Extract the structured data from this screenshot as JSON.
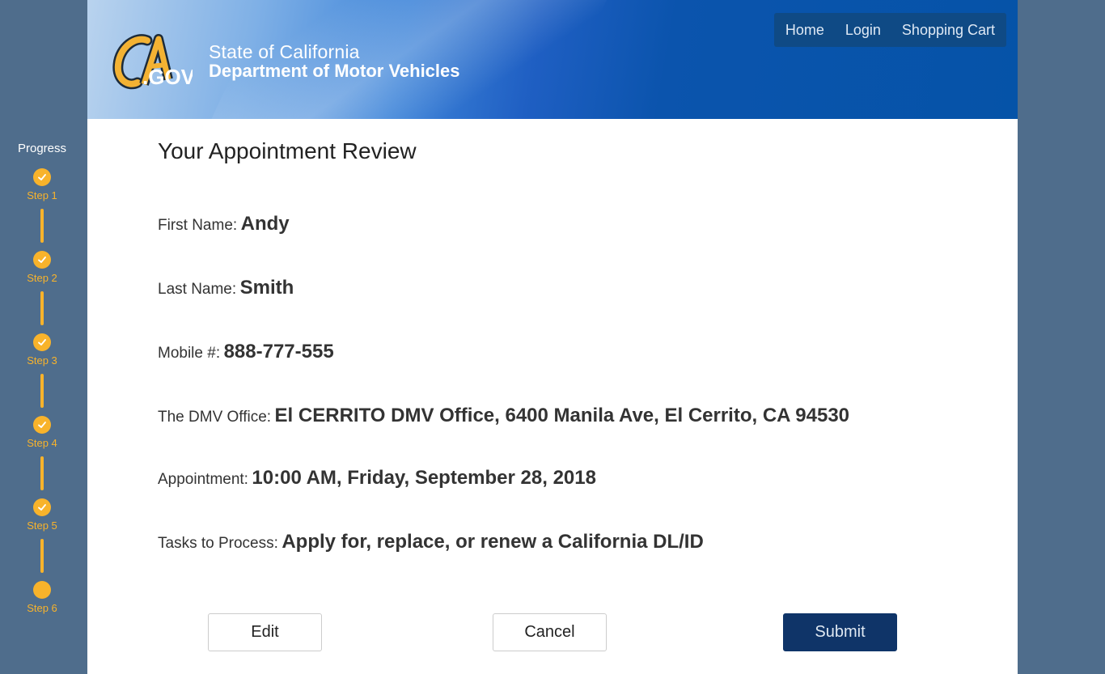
{
  "header": {
    "logo_text": "CA.GOV",
    "state": "State of California",
    "department": "Department of Motor Vehicles"
  },
  "nav": {
    "items": [
      {
        "label": "Home"
      },
      {
        "label": "Login"
      },
      {
        "label": "Shopping Cart"
      }
    ]
  },
  "progress": {
    "title": "Progress",
    "steps": [
      {
        "label": "Step 1",
        "state": "completed"
      },
      {
        "label": "Step 2",
        "state": "completed"
      },
      {
        "label": "Step 3",
        "state": "completed"
      },
      {
        "label": "Step 4",
        "state": "completed"
      },
      {
        "label": "Step 5",
        "state": "completed"
      },
      {
        "label": "Step 6",
        "state": "current"
      }
    ]
  },
  "review": {
    "title": "Your Appointment Review",
    "fields": [
      {
        "label": "First Name:",
        "value": "Andy"
      },
      {
        "label": "Last Name:",
        "value": "Smith"
      },
      {
        "label": "Mobile #:",
        "value": "888-777-555"
      },
      {
        "label": "The DMV Office:",
        "value": "El CERRITO DMV Office, 6400 Manila Ave, El Cerrito, CA 94530"
      },
      {
        "label": "Appointment:",
        "value": "10:00 AM, Friday, September 28, 2018"
      },
      {
        "label": "Tasks to Process:",
        "value": "Apply for, replace, or renew a California DL/ID"
      }
    ]
  },
  "actions": {
    "edit_label": "Edit",
    "cancel_label": "Cancel",
    "submit_label": "Submit"
  },
  "colors": {
    "accent": "#f8b32b",
    "sidebar": "#4f6d8c",
    "submit": "#0f3468"
  }
}
